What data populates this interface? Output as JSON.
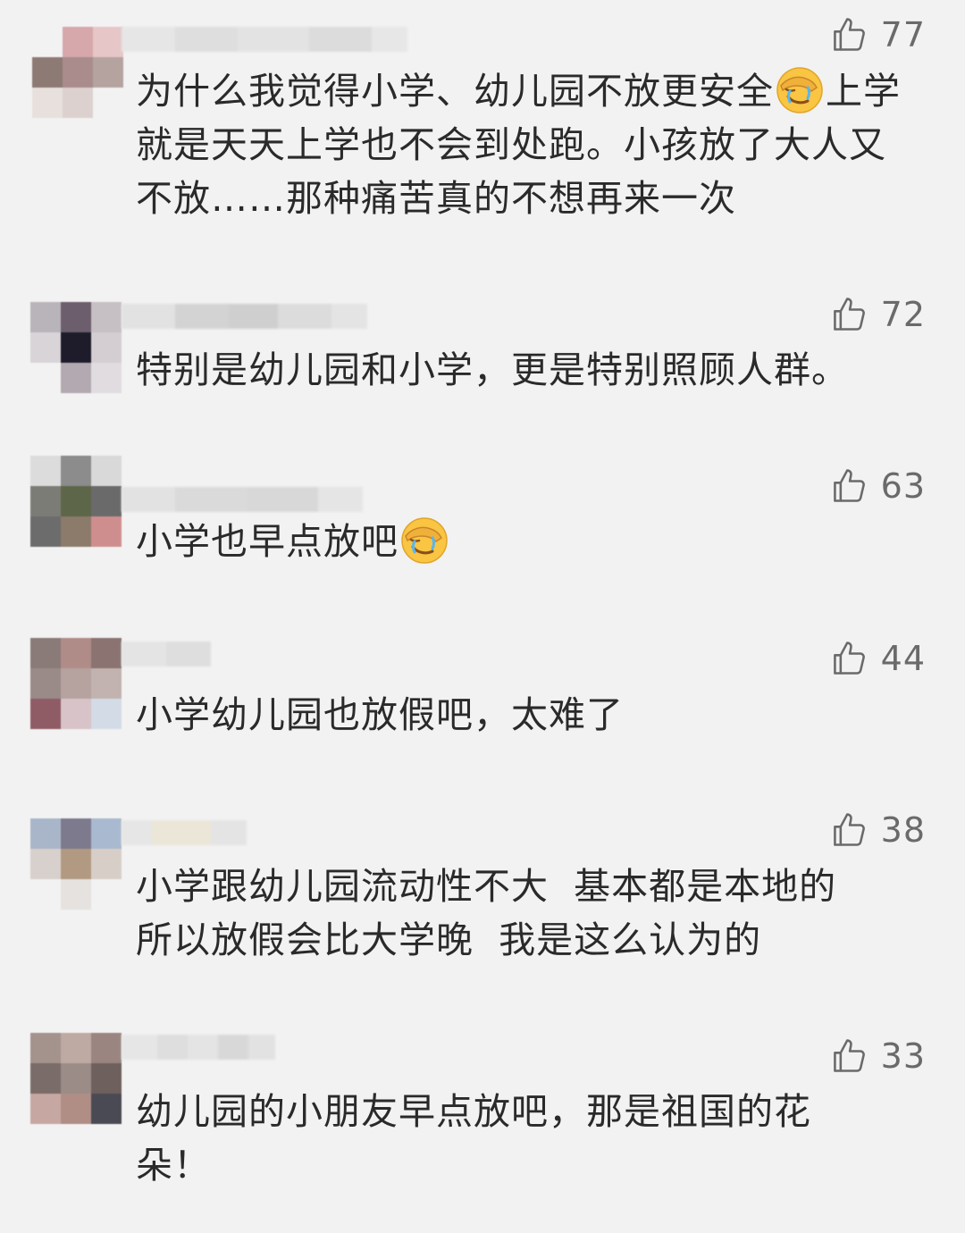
{
  "comments": [
    {
      "likes": "77",
      "text_before": "为什么我觉得小学、幼儿园不放更安全",
      "emoji": "facepalm-crying-emoji",
      "text_after": "上学就是天天上学也不会到处跑。小孩放了大人又不放……那种痛苦真的不想再来一次"
    },
    {
      "likes": "72",
      "text_before": "特别是幼儿园和小学，更是特别照顾人群。"
    },
    {
      "likes": "63",
      "text_before": "小学也早点放吧",
      "emoji": "facepalm-crying-emoji"
    },
    {
      "likes": "44",
      "text_before": "小学幼儿园也放假吧，太难了"
    },
    {
      "likes": "38",
      "text_before": "小学跟幼儿园流动性不大  基本都是本地的\n所以放假会比大学晚  我是这么认为的"
    },
    {
      "likes": "33",
      "text_before": "幼儿园的小朋友早点放吧，那是祖国的花朵！"
    }
  ],
  "icons": {
    "like": "thumbs-up-outline-icon",
    "avatar": "pixelated-avatar",
    "username": "blurred-username"
  },
  "colors": {
    "background": "#f2f2f2",
    "text": "#2a2a2a",
    "like": "#6a6a6a"
  }
}
